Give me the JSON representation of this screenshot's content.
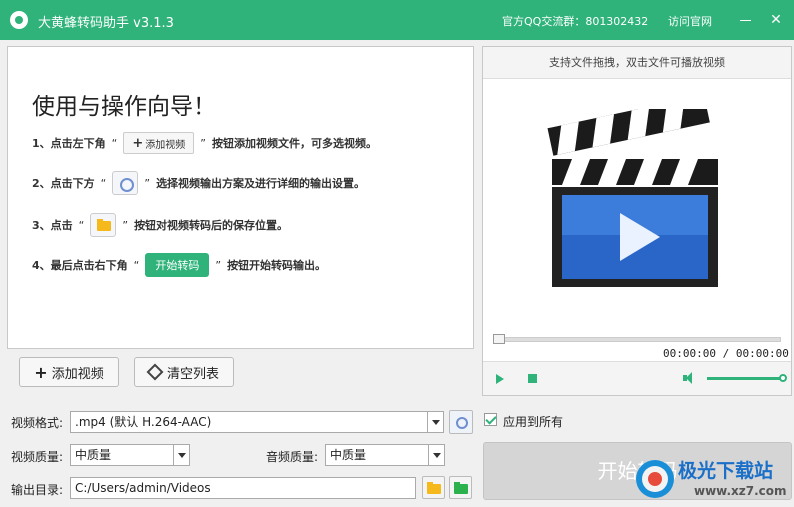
{
  "titlebar": {
    "app_title": "大黄蜂转码助手 v3.1.3",
    "qq_group": "官方QQ交流群：801302432",
    "visit_site": "访问官网",
    "close": "✕"
  },
  "guide": {
    "title": "使用与操作向导！",
    "steps": [
      {
        "prefix": "1、点击左下角",
        "button": "添加视频",
        "suffix": "按钮添加视频文件，可多选视频。"
      },
      {
        "prefix": "2、点击下方",
        "suffix": "选择视频输出方案及进行详细的输出设置。"
      },
      {
        "prefix": "3、点击",
        "suffix": "按钮对视频转码后的保存位置。"
      },
      {
        "prefix": "4、最后点击右下角",
        "button": "开始转码",
        "suffix": "按钮开始转码输出。"
      }
    ],
    "quote_open": "“",
    "quote_close": "”",
    "plus": "+"
  },
  "list_buttons": {
    "add_video": "添加视频",
    "clear_list": "清空列表",
    "plus": "+"
  },
  "player": {
    "hint": "支持文件拖拽，双击文件可播放视频",
    "time": "00:00:00 / 00:00:00",
    "progress": 0,
    "volume": 1.0
  },
  "settings": {
    "format_label": "视频格式:",
    "format_value": ".mp4 (默认 H.264-AAC)",
    "apply_all_label": "应用到所有",
    "apply_all_checked": true,
    "video_quality_label": "视频质量:",
    "video_quality_value": "中质量",
    "audio_quality_label": "音频质量:",
    "audio_quality_value": "中质量",
    "output_label": "输出目录:",
    "output_value": "C:/Users/admin/Videos"
  },
  "start_button": "开始转码",
  "watermark": {
    "name": "极光下载站",
    "url": "www.xz7.com"
  },
  "colors": {
    "accent": "#2fb37a",
    "disabled": "#d5d5d5"
  }
}
